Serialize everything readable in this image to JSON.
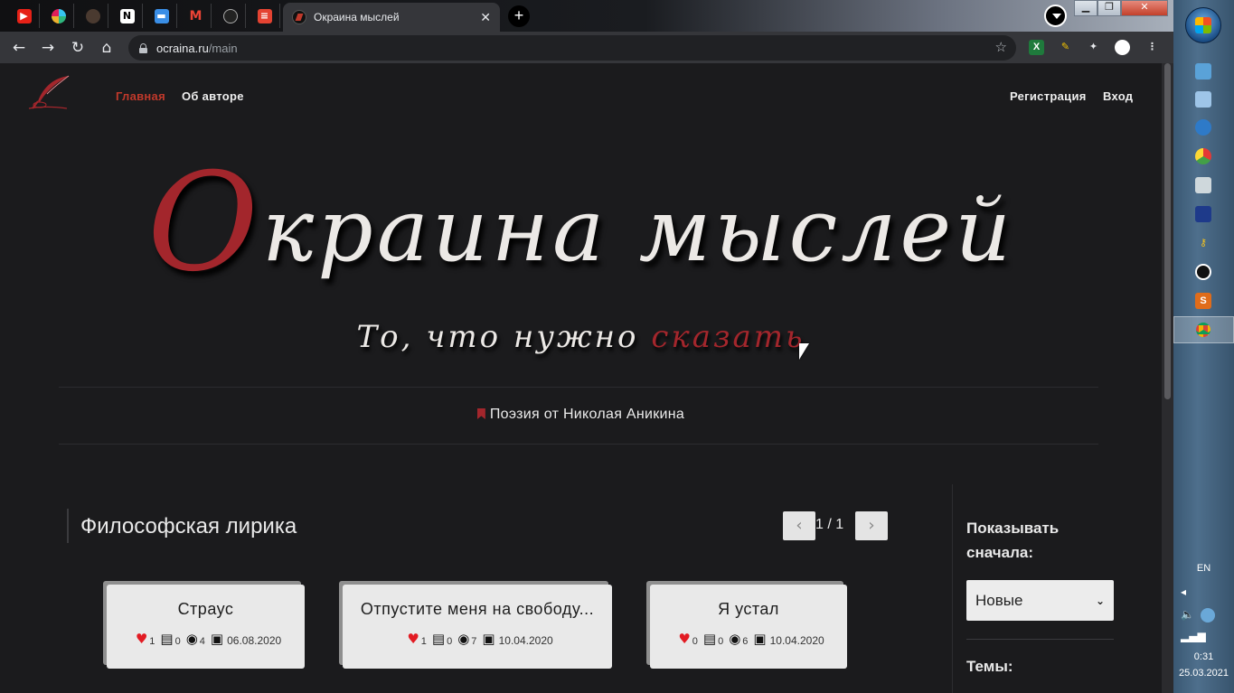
{
  "browser": {
    "active_tab_title": "Окраина мыслей",
    "close_glyph": "✕",
    "new_tab_glyph": "+",
    "url_host": "ocraina.ru",
    "url_path": "/main",
    "pinned_tabs": [
      "youtube-icon",
      "slack-icon",
      "dark-avatar-icon",
      "notion-icon",
      "chat-icon",
      "gmail-icon",
      "github-icon",
      "todoist-icon"
    ],
    "window_buttons": {
      "minimize": "▁",
      "maximize": "❐",
      "close": "✕"
    }
  },
  "site": {
    "nav": {
      "home": "Главная",
      "about": "Об авторе",
      "register": "Регистрация",
      "login": "Вход"
    },
    "hero": {
      "title_first_letter": "О",
      "title_rest": "краина мыслей",
      "subtitle_main": "То, что нужно ",
      "subtitle_accent": "сказать"
    },
    "tagline": "Поэзия от Николая Аникина",
    "section": {
      "title": "Философская лирика",
      "pagination": "1 / 1",
      "prev": "‹",
      "next": "›"
    },
    "sidebar": {
      "sort_label": "Показывать сначала:",
      "sort_value": "Новые",
      "themes_label": "Темы:"
    },
    "cards": [
      {
        "title": "Страус",
        "likes": "1",
        "comments": "0",
        "views": "4",
        "date": "06.08.2020"
      },
      {
        "title": "Отпустите меня на свободу...",
        "likes": "1",
        "comments": "0",
        "views": "7",
        "date": "10.04.2020"
      },
      {
        "title": "Я устал",
        "likes": "0",
        "comments": "0",
        "views": "6",
        "date": "10.04.2020"
      }
    ],
    "colors": {
      "accent": "#a3262c",
      "background": "#1b1b1d",
      "card": "#e9e9e9"
    }
  },
  "taskbar": {
    "language": "EN",
    "time": "0:31",
    "date": "25.03.2021"
  }
}
